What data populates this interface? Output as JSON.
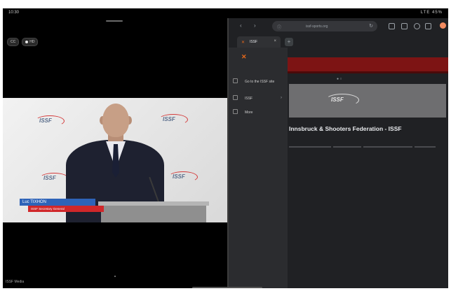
{
  "status_bar": {
    "time": "10:30",
    "right": "LTE 45%"
  },
  "left_pane": {
    "pills": [
      "CC",
      "HD"
    ],
    "video": {
      "logos": [
        "ISSF",
        "ISSF",
        "ISSF",
        "ISSF"
      ],
      "lower_third": {
        "name": "Luc TIXHON",
        "title": "ISSF Secretary General"
      }
    },
    "caption": "ISSF Media"
  },
  "browser": {
    "url": "issf-sports.org",
    "tab_title": "ISSF",
    "new_tab_label": "+",
    "sidebar": {
      "logo": "✕",
      "items": [
        "Go to the ISSF site",
        "ISSF",
        "More"
      ]
    },
    "page": {
      "hero_logo": "ISSF",
      "heading": "Innsbruck & Shooters Federation - ISSF"
    }
  },
  "colors": {
    "banner": "#7d1414",
    "accent": "#e8691b",
    "lower_third_blue": "#2e63b8",
    "lower_third_red": "#d0272a"
  }
}
